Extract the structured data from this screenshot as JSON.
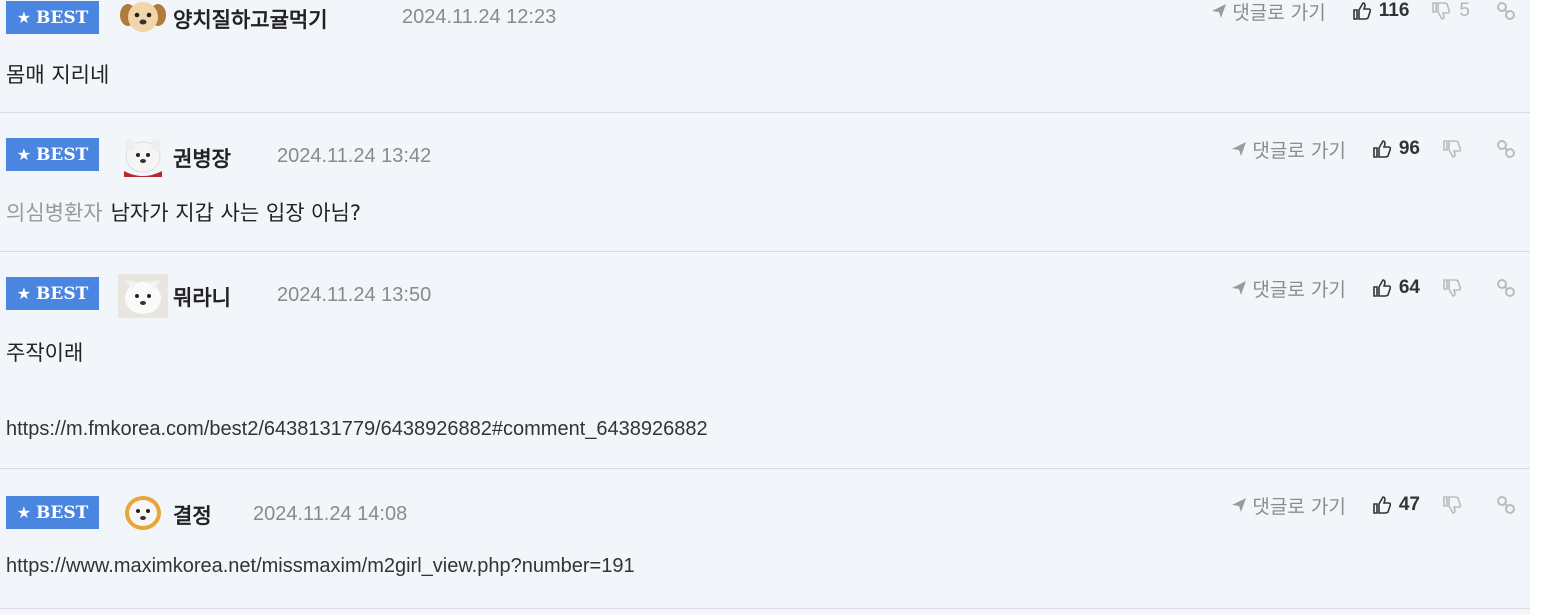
{
  "comments": [
    {
      "badge": "BEST",
      "nickname": "양치질하고귤먹기",
      "date": "2024.11.24 12:23",
      "goto_label": "댓글로 가기",
      "upvotes": "116",
      "downvotes": "5",
      "reply_to": "",
      "text": "몸매 지리네",
      "url": ""
    },
    {
      "badge": "BEST",
      "nickname": "권병장",
      "date": "2024.11.24 13:42",
      "goto_label": "댓글로 가기",
      "upvotes": "96",
      "downvotes": "",
      "reply_to": "의심병환자",
      "text": "남자가 지갑 사는 입장 아님?",
      "url": ""
    },
    {
      "badge": "BEST",
      "nickname": "뭐라니",
      "date": "2024.11.24 13:50",
      "goto_label": "댓글로 가기",
      "upvotes": "64",
      "downvotes": "",
      "reply_to": "",
      "text": "주작이래",
      "url": "https://m.fmkorea.com/best2/6438131779/6438926882#comment_6438926882"
    },
    {
      "badge": "BEST",
      "nickname": "결정",
      "date": "2024.11.24 14:08",
      "goto_label": "댓글로 가기",
      "upvotes": "47",
      "downvotes": "",
      "reply_to": "",
      "text": "",
      "url": "https://www.maximkorea.net/missmaxim/m2girl_view.php?number=191"
    }
  ],
  "icons": {
    "badge_star": "star-icon",
    "goto": "send-arrow-icon",
    "upvote": "thumbs-up-icon",
    "downvote": "thumbs-down-icon",
    "link": "link-icon"
  },
  "colors": {
    "badge_bg": "#4a86e0",
    "list_bg": "#f2f6fb",
    "divider": "#d9dde3",
    "date": "#8a8a8a"
  }
}
